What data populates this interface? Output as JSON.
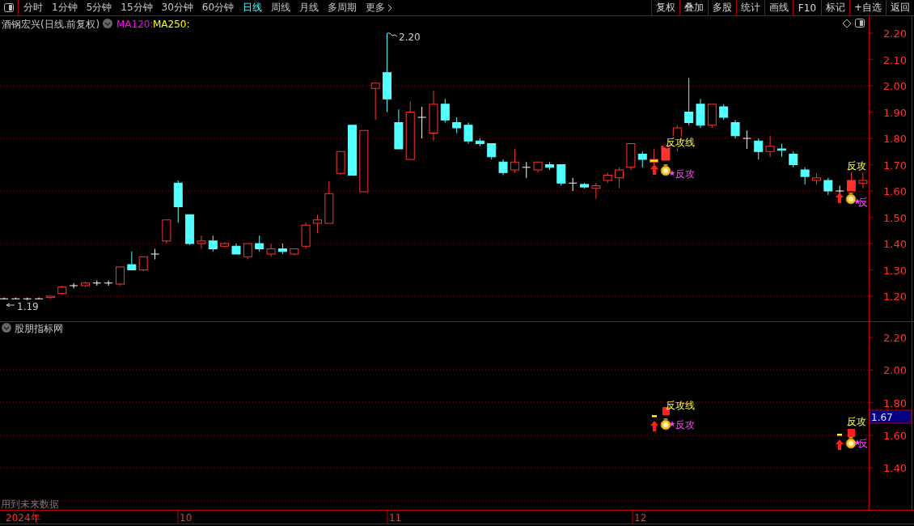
{
  "toolbar": {
    "periods": [
      {
        "label": "分时",
        "selected": false
      },
      {
        "label": "1分钟",
        "selected": false
      },
      {
        "label": "5分钟",
        "selected": false
      },
      {
        "label": "15分钟",
        "selected": false
      },
      {
        "label": "30分钟",
        "selected": false
      },
      {
        "label": "60分钟",
        "selected": false
      },
      {
        "label": "日线",
        "selected": true
      },
      {
        "label": "周线",
        "selected": false
      },
      {
        "label": "月线",
        "selected": false
      },
      {
        "label": "多周期",
        "selected": false
      },
      {
        "label": "更多",
        "selected": false
      }
    ],
    "buttons": [
      "复权",
      "叠加",
      "多股",
      "统计",
      "画线",
      "F10",
      "标记",
      "+自选",
      "返回"
    ]
  },
  "main_chart": {
    "title": "酒钢宏兴(日线.前复权)",
    "indicators": [
      {
        "label": "MA120:",
        "color": "#ff00ff"
      },
      {
        "label": "MA250:",
        "color": "#ffff00"
      }
    ],
    "y_ticks": [
      "2.20",
      "2.10",
      "2.00",
      "1.90",
      "1.80",
      "1.70",
      "1.60",
      "1.50",
      "1.40",
      "1.30",
      "1.20"
    ],
    "high_label": "2.20",
    "low_label": "1.19",
    "signals": [
      {
        "line_label": "反攻线",
        "tag": "反攻"
      },
      {
        "line_label": "反攻",
        "tag": "反"
      }
    ]
  },
  "indicator_panel": {
    "title": "股朋指标网",
    "y_ticks": [
      "2.20",
      "2.00",
      "1.80",
      "1.60",
      "1.40"
    ],
    "current_value": "1.67",
    "signals": [
      {
        "line_label": "反攻线",
        "tag": "反攻"
      },
      {
        "line_label": "反攻",
        "tag": "反"
      }
    ],
    "note": "用到未来数据"
  },
  "date_axis": [
    "2024年",
    "10",
    "11",
    "12"
  ]
}
